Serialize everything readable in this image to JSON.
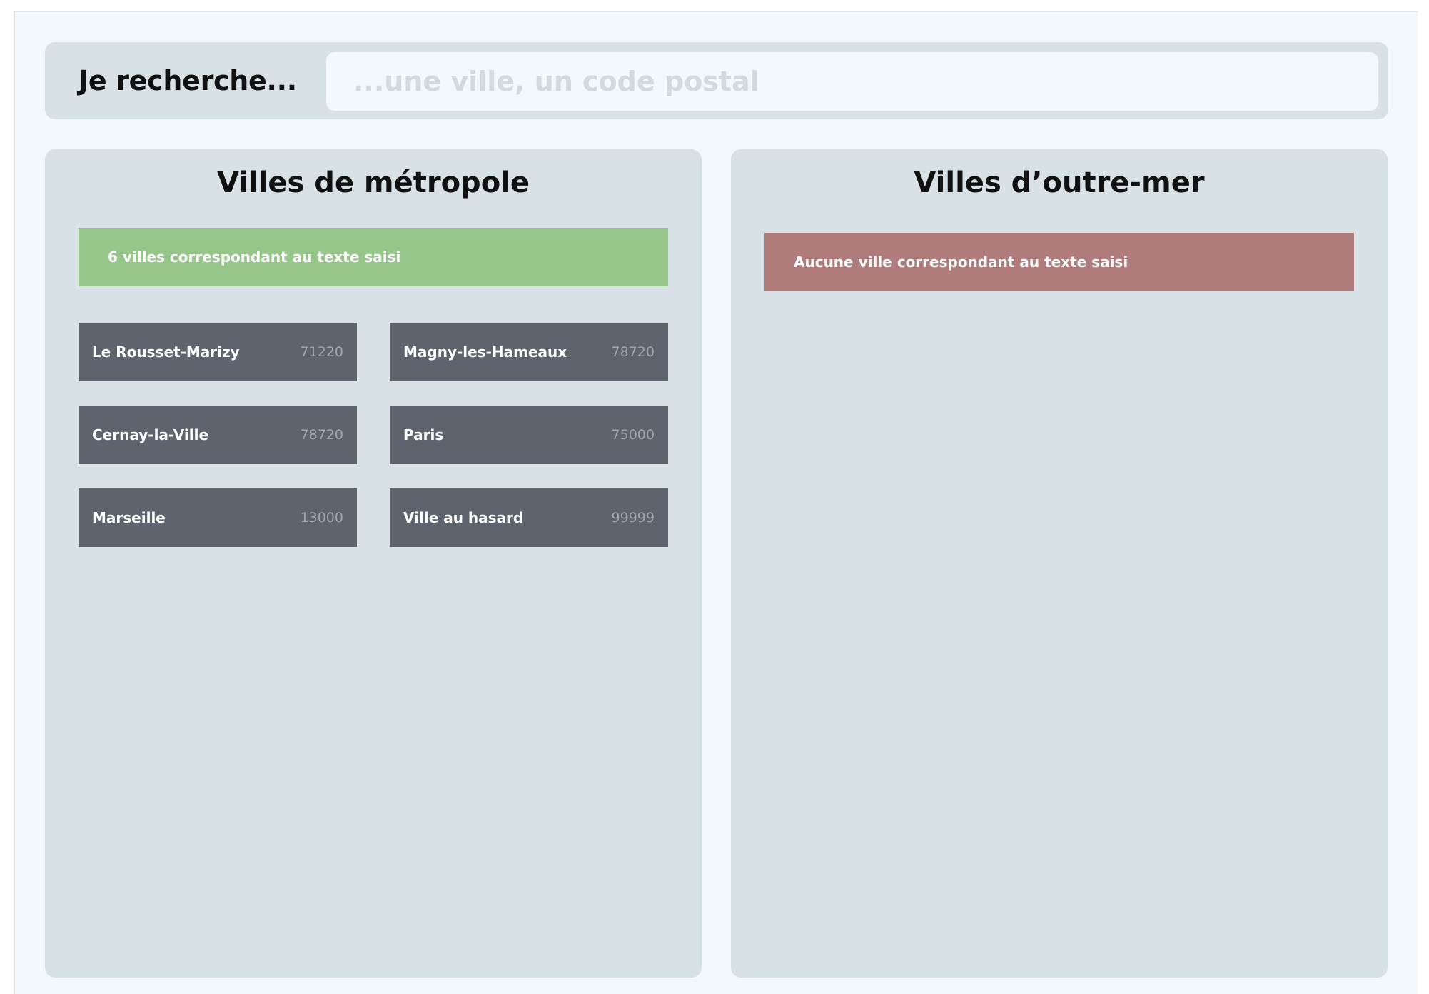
{
  "search": {
    "label": "Je recherche...",
    "value": "",
    "placeholder": "...une ville, un code postal"
  },
  "metropole": {
    "title": "Villes de métropole",
    "status": "6 villes correspondant au texte saisi",
    "status_color": "#96c68a",
    "cities": [
      {
        "name": "Le Rousset-Marizy",
        "code": "71220"
      },
      {
        "name": "Magny-les-Hameaux",
        "code": "78720"
      },
      {
        "name": "Cernay-la-Ville",
        "code": "78720"
      },
      {
        "name": "Paris",
        "code": "75000"
      },
      {
        "name": "Marseille",
        "code": "13000"
      },
      {
        "name": "Ville au hasard",
        "code": "99999"
      }
    ]
  },
  "outremer": {
    "title": "Villes d’outre-mer",
    "status": "Aucune ville correspondant au texte saisi",
    "status_color": "#b07b7b",
    "cities": []
  },
  "colors": {
    "page_bg": "#f2f8fb",
    "panel_bg": "#d8e2e6",
    "card_bg": "#5e646d",
    "card_code": "#a1a6ad"
  }
}
